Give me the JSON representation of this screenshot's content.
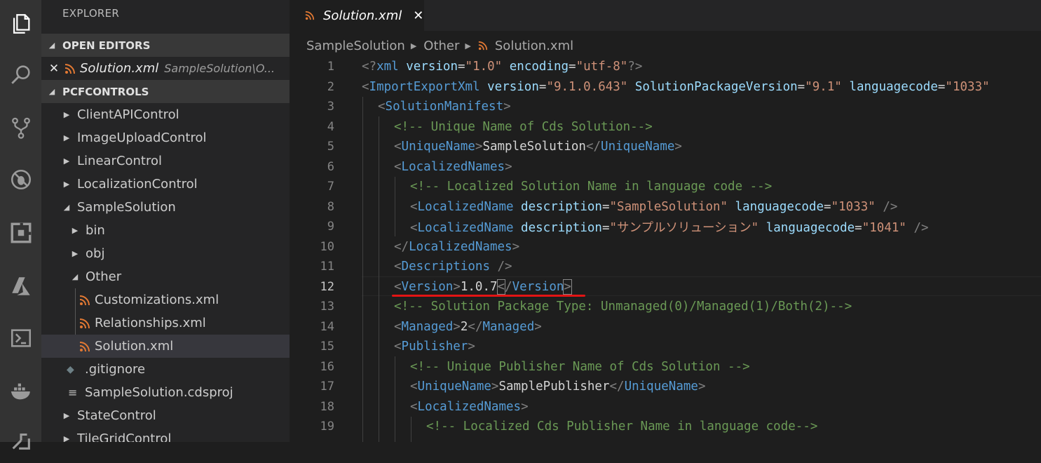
{
  "activity_bar": {
    "icons": [
      "files-icon",
      "search-icon",
      "source-control-icon",
      "debug-icon",
      "extensions-icon",
      "azure-icon",
      "terminal-icon",
      "docker-icon",
      "remote-icon"
    ]
  },
  "sidebar": {
    "title": "EXPLORER",
    "open_editors": {
      "label": "OPEN EDITORS",
      "file": "Solution.xml",
      "path": "SampleSolution\\O..."
    },
    "project": {
      "label": "PCFCONTROLS",
      "items": [
        {
          "label": "ClientAPIControl"
        },
        {
          "label": "ImageUploadControl"
        },
        {
          "label": "LinearControl"
        },
        {
          "label": "LocalizationControl"
        },
        {
          "label": "SampleSolution"
        },
        {
          "label": "bin"
        },
        {
          "label": "obj"
        },
        {
          "label": "Other"
        },
        {
          "label": "Customizations.xml"
        },
        {
          "label": "Relationships.xml"
        },
        {
          "label": "Solution.xml"
        },
        {
          "label": ".gitignore"
        },
        {
          "label": "SampleSolution.cdsproj"
        },
        {
          "label": "StateControl"
        },
        {
          "label": "TileGridControl"
        }
      ]
    }
  },
  "editor": {
    "tab": {
      "label": "Solution.xml",
      "close": "✕"
    },
    "breadcrumb": [
      "SampleSolution",
      "Other",
      "Solution.xml"
    ],
    "current_line": 12,
    "line_numbers": [
      "1",
      "2",
      "3",
      "4",
      "5",
      "6",
      "7",
      "8",
      "9",
      "10",
      "11",
      "12",
      "13",
      "14",
      "15",
      "16",
      "17",
      "18",
      "19"
    ],
    "code": {
      "l1": {
        "t1": "<?",
        "n1": "xml",
        "a1": " version",
        "p1": "=",
        "s1": "\"1.0\"",
        "a2": " encoding",
        "p2": "=",
        "s2": "\"utf-8\"",
        "t2": "?>"
      },
      "l2": {
        "t1": "<",
        "n1": "ImportExportXml",
        "a1": " version",
        "p1": "=",
        "s1": "\"9.1.0.643\"",
        "a2": " SolutionPackageVersion",
        "p2": "=",
        "s2": "\"9.1\"",
        "a3": " languagecode",
        "p3": "=",
        "s3": "\"1033\""
      },
      "l3": {
        "t1": "<",
        "n1": "SolutionManifest",
        "t2": ">"
      },
      "l4": {
        "c1": "<!-- Unique Name of Cds Solution-->"
      },
      "l5": {
        "t1": "<",
        "n1": "UniqueName",
        "t2": ">",
        "p1": "SampleSolution",
        "t3": "</",
        "n2": "UniqueName",
        "t4": ">"
      },
      "l6": {
        "t1": "<",
        "n1": "LocalizedNames",
        "t2": ">"
      },
      "l7": {
        "c1": "<!-- Localized Solution Name in language code -->"
      },
      "l8": {
        "t1": "<",
        "n1": "LocalizedName",
        "a1": " description",
        "p1": "=",
        "s1": "\"SampleSolution\"",
        "a2": " languagecode",
        "p2": "=",
        "s2": "\"1033\"",
        "t2": " />"
      },
      "l9": {
        "t1": "<",
        "n1": "LocalizedName",
        "a1": " description",
        "p1": "=",
        "s1": "\"サンプルソリューション\"",
        "a2": " languagecode",
        "p2": "=",
        "s2": "\"1041\"",
        "t2": " />"
      },
      "l10": {
        "t1": "</",
        "n1": "LocalizedNames",
        "t2": ">"
      },
      "l11": {
        "t1": "<",
        "n1": "Descriptions",
        "t2": " />"
      },
      "l12": {
        "t1": "<",
        "n1": "Version",
        "t2": ">",
        "p1": "1.0.7",
        "t3": "<",
        "t4": "/",
        "n2": "Version",
        "t5": ">"
      },
      "l13": {
        "c1": "<!-- Solution Package Type: Unmanaged(0)/Managed(1)/Both(2)-->"
      },
      "l14": {
        "t1": "<",
        "n1": "Managed",
        "t2": ">",
        "p1": "2",
        "t3": "</",
        "n2": "Managed",
        "t4": ">"
      },
      "l15": {
        "t1": "<",
        "n1": "Publisher",
        "t2": ">"
      },
      "l16": {
        "c1": "<!-- Unique Publisher Name of Cds Solution -->"
      },
      "l17": {
        "t1": "<",
        "n1": "UniqueName",
        "t2": ">",
        "p1": "SamplePublisher",
        "t3": "</",
        "n2": "UniqueName",
        "t4": ">"
      },
      "l18": {
        "t1": "<",
        "n1": "LocalizedNames",
        "t2": ">"
      },
      "l19": {
        "c1": "<!-- Localized Cds Publisher Name in language code-->"
      }
    }
  },
  "colors": {
    "xml_icon": "#e37933",
    "tag_name": "#569cd6",
    "attribute": "#9cdcfe",
    "string": "#ce9178",
    "comment": "#6a9955",
    "annotation_underline": "#e31414"
  }
}
